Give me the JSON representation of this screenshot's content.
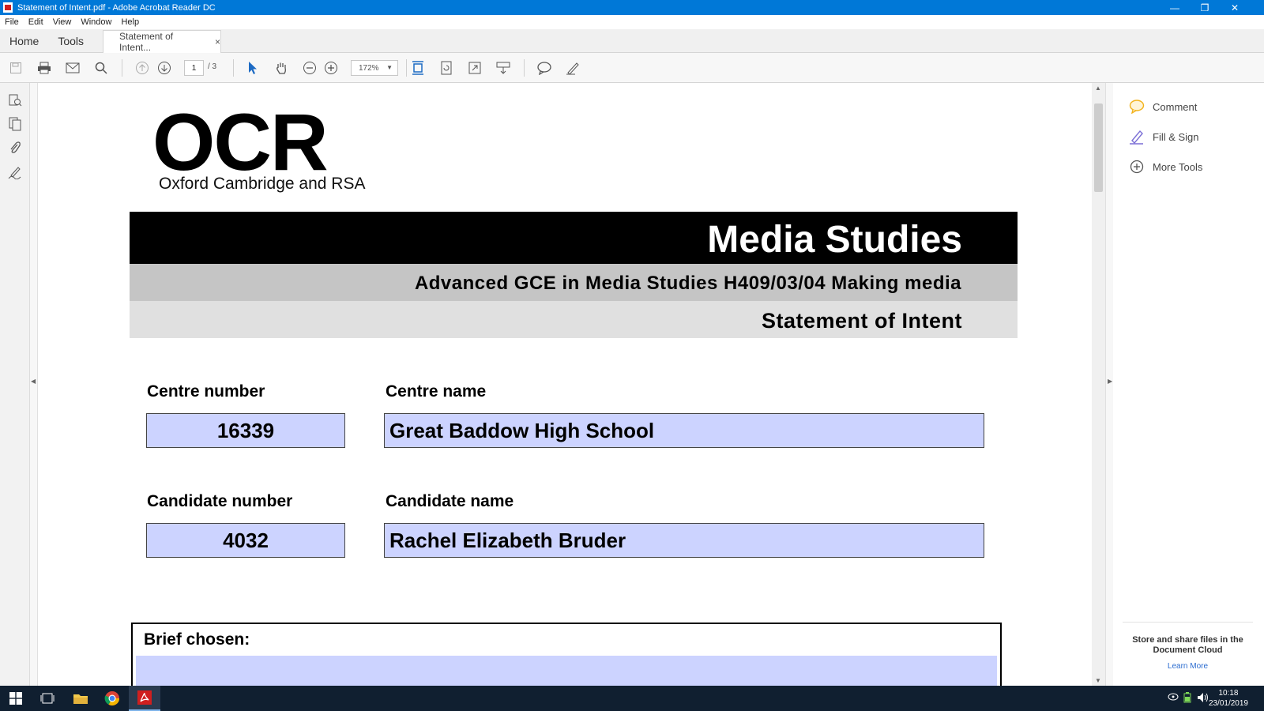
{
  "window": {
    "title": "Statement of Intent.pdf - Adobe Acrobat Reader DC",
    "minimize": "—",
    "restore": "❐",
    "close": "✕"
  },
  "menu": [
    "File",
    "Edit",
    "View",
    "Window",
    "Help"
  ],
  "tabs": {
    "home": "Home",
    "tools": "Tools",
    "document": "Statement of Intent...",
    "close": "×"
  },
  "toolbar": {
    "page_current": "1",
    "page_total": "/ 3",
    "zoom": "172%",
    "icons": [
      "save-icon",
      "print-icon",
      "email-icon",
      "search-icon",
      "prev-page-icon",
      "next-page-icon",
      "select-tool-icon",
      "hand-tool-icon",
      "zoom-out-icon",
      "zoom-in-icon",
      "fit-page-icon",
      "rotate-icon",
      "full-screen-icon",
      "scroll-mode-icon",
      "comment-icon",
      "sign-icon"
    ]
  },
  "right_pane": {
    "items": [
      {
        "label": "Comment",
        "icon": "comment-icon",
        "color": "#f2b21b"
      },
      {
        "label": "Fill & Sign",
        "icon": "fill-sign-icon",
        "color": "#7b6fd6"
      },
      {
        "label": "More Tools",
        "icon": "more-tools-icon",
        "color": "#555555"
      }
    ],
    "cloud_text": "Store and share files in the Document Cloud",
    "learn_more": "Learn More"
  },
  "document": {
    "logo": "OCR",
    "logo_sub": "Oxford Cambridge and RSA",
    "heading": "Media Studies",
    "subheading": "Advanced GCE in Media Studies H409/03/04 Making media",
    "form_title": "Statement of Intent",
    "fields": {
      "centre_number_label": "Centre number",
      "centre_number": "16339",
      "centre_name_label": "Centre name",
      "centre_name": "Great Baddow High School",
      "candidate_number_label": "Candidate number",
      "candidate_number": "4032",
      "candidate_name_label": "Candidate name",
      "candidate_name": "Rachel Elizabeth Bruder"
    },
    "brief_label": "Brief chosen:"
  },
  "taskbar": {
    "time": "10:18",
    "date": "23/01/2019"
  },
  "colors": {
    "titlebar": "#0078d7",
    "field_fill": "#ccd3ff",
    "taskbar": "#101f30"
  }
}
